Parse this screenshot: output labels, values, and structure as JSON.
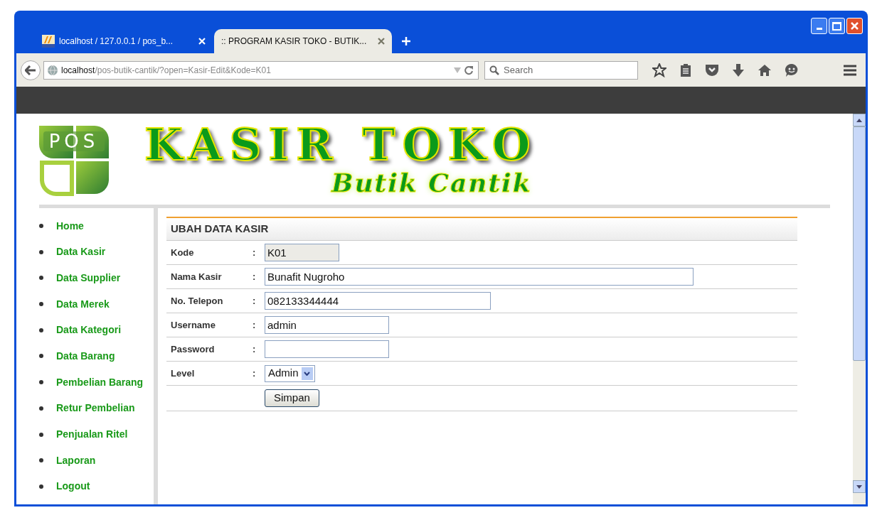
{
  "browser": {
    "tabs": [
      {
        "label": "localhost / 127.0.0.1 / pos_b...",
        "selected": false
      },
      {
        "label": ":: PROGRAM KASIR TOKO - BUTIK...",
        "selected": true
      }
    ],
    "address": {
      "host": "localhost",
      "path": "/pos-butik-cantik/?open=Kasir-Edit&Kode=K01"
    },
    "search": {
      "placeholder": "Search"
    }
  },
  "header": {
    "logo_text": "POS",
    "title": "KASIR TOKO",
    "subtitle": "Butik Cantik"
  },
  "menu": [
    "Home",
    "Data Kasir",
    "Data Supplier",
    "Data Merek",
    "Data Kategori",
    "Data Barang",
    "Pembelian Barang",
    "Retur Pembelian",
    "Penjualan Ritel",
    "Laporan",
    "Logout"
  ],
  "form": {
    "title": "UBAH DATA KASIR",
    "rows": [
      {
        "label": "Kode",
        "colon": ":",
        "kind": "readonly",
        "value": "K01"
      },
      {
        "label": "Nama Kasir",
        "colon": ":",
        "kind": "input",
        "value": "Bunafit Nugroho"
      },
      {
        "label": "No. Telepon",
        "colon": ":",
        "kind": "input",
        "value": "082133344444"
      },
      {
        "label": "Username",
        "colon": ":",
        "kind": "input",
        "value": "admin"
      },
      {
        "label": "Password",
        "colon": ":",
        "kind": "password"
      },
      {
        "label": "Level",
        "colon": ":",
        "kind": "select",
        "value": "Admin"
      }
    ],
    "button": "Simpan"
  }
}
